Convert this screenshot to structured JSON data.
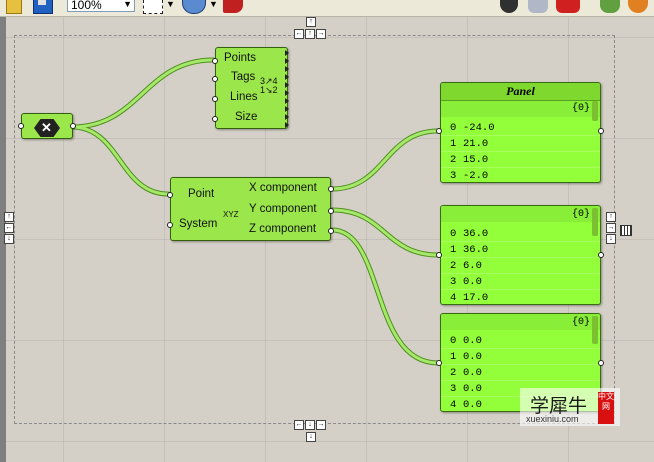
{
  "toolbar": {
    "zoom": "100%",
    "icons": [
      "open-icon",
      "save-icon",
      "zoom-select",
      "sketch-icon",
      "preview-eye-icon",
      "brush-icon",
      "shaded-preview-icon",
      "wire-icon",
      "bake-icon",
      "render-icon",
      "color-icon"
    ]
  },
  "nav_arrows": {
    "up": "↑",
    "down": "↓",
    "left": "←",
    "right": "→"
  },
  "components": {
    "param_icon": "grasshopper-hex-icon",
    "list_item": {
      "inputs": [
        "Points",
        "Tags",
        "Lines",
        "Size"
      ],
      "glyph": "3↗4 1↘2"
    },
    "deconstruct": {
      "inputs": [
        "Point",
        "System"
      ],
      "outputs": [
        "X component",
        "Y component",
        "Z component"
      ],
      "glyph": "XYZ"
    }
  },
  "panels": [
    {
      "title": "Panel",
      "path": "{0}",
      "rows": [
        {
          "index": "0",
          "value": "-24.0"
        },
        {
          "index": "1",
          "value": "21.0"
        },
        {
          "index": "2",
          "value": "15.0"
        },
        {
          "index": "3",
          "value": "-2.0"
        }
      ]
    },
    {
      "title": "",
      "path": "{0}",
      "rows": [
        {
          "index": "0",
          "value": "36.0"
        },
        {
          "index": "1",
          "value": "36.0"
        },
        {
          "index": "2",
          "value": "6.0"
        },
        {
          "index": "3",
          "value": "0.0"
        },
        {
          "index": "4",
          "value": "17.0"
        }
      ]
    },
    {
      "title": "",
      "path": "{0}",
      "rows": [
        {
          "index": "0",
          "value": "0.0"
        },
        {
          "index": "1",
          "value": "0.0"
        },
        {
          "index": "2",
          "value": "0.0"
        },
        {
          "index": "3",
          "value": "0.0"
        },
        {
          "index": "4",
          "value": "0.0"
        }
      ]
    }
  ],
  "watermark": {
    "title": "学犀牛",
    "url": "xuexiniu.com",
    "badge": "中文网"
  },
  "colors": {
    "component": "#9be64b",
    "panel": "#93ff3a",
    "wire": "#7ccc3a",
    "canvas": "#d4d0c8"
  }
}
